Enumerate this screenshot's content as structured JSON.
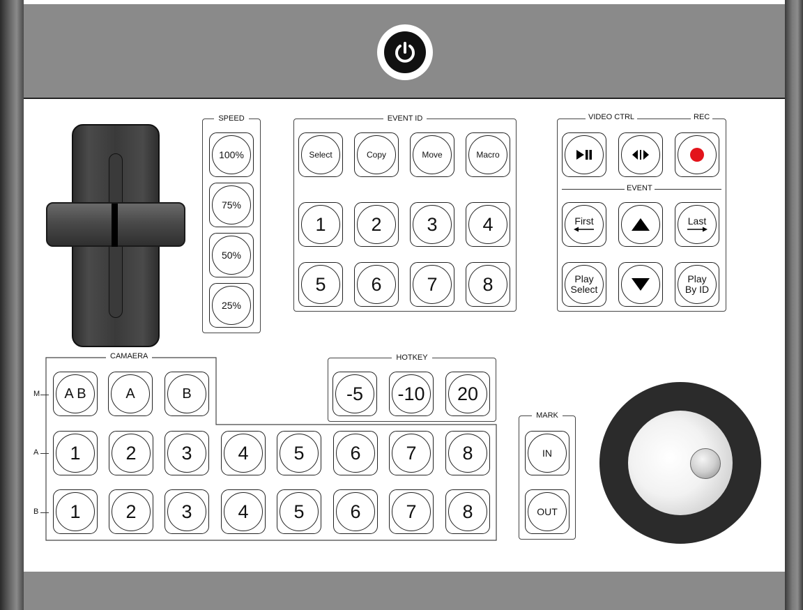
{
  "groups": {
    "speed": "SPEED",
    "event_id": "EVENT ID",
    "video_ctrl": "VIDEO CTRL",
    "rec": "REC",
    "event": "EVENT",
    "camera": "CAMAERA",
    "hotkey": "HOTKEY",
    "mark": "MARK"
  },
  "speed_keys": [
    "100%",
    "75%",
    "50%",
    "25%"
  ],
  "event_id_keys": {
    "functions": [
      "Select",
      "Copy",
      "Move",
      "Macro"
    ],
    "numbers_row1": [
      "1",
      "2",
      "3",
      "4"
    ],
    "numbers_row2": [
      "5",
      "6",
      "7",
      "8"
    ]
  },
  "video_ctrl": {
    "play_pause_icon": "play-pause-icon",
    "jog_icon": "frame-step-icon",
    "rec_icon": "record-icon",
    "rec_color": "#e3141b"
  },
  "event_keys": {
    "first": "First",
    "last": "Last",
    "play_select_1": "Play",
    "play_select_2": "Select",
    "play_by_id_1": "Play",
    "play_by_id_2": "By ID",
    "up_icon": "up-triangle-icon",
    "down_icon": "down-triangle-icon"
  },
  "camera": {
    "row_labels": [
      "M",
      "A",
      "B"
    ],
    "m_keys": [
      "A B",
      "A",
      "B"
    ],
    "a_keys": [
      "1",
      "2",
      "3",
      "4",
      "5",
      "6",
      "7",
      "8"
    ],
    "b_keys": [
      "1",
      "2",
      "3",
      "4",
      "5",
      "6",
      "7",
      "8"
    ]
  },
  "hotkey_keys": [
    "-5",
    "-10",
    "20"
  ],
  "mark_keys": [
    "IN",
    "OUT"
  ],
  "power_icon": "power-icon"
}
